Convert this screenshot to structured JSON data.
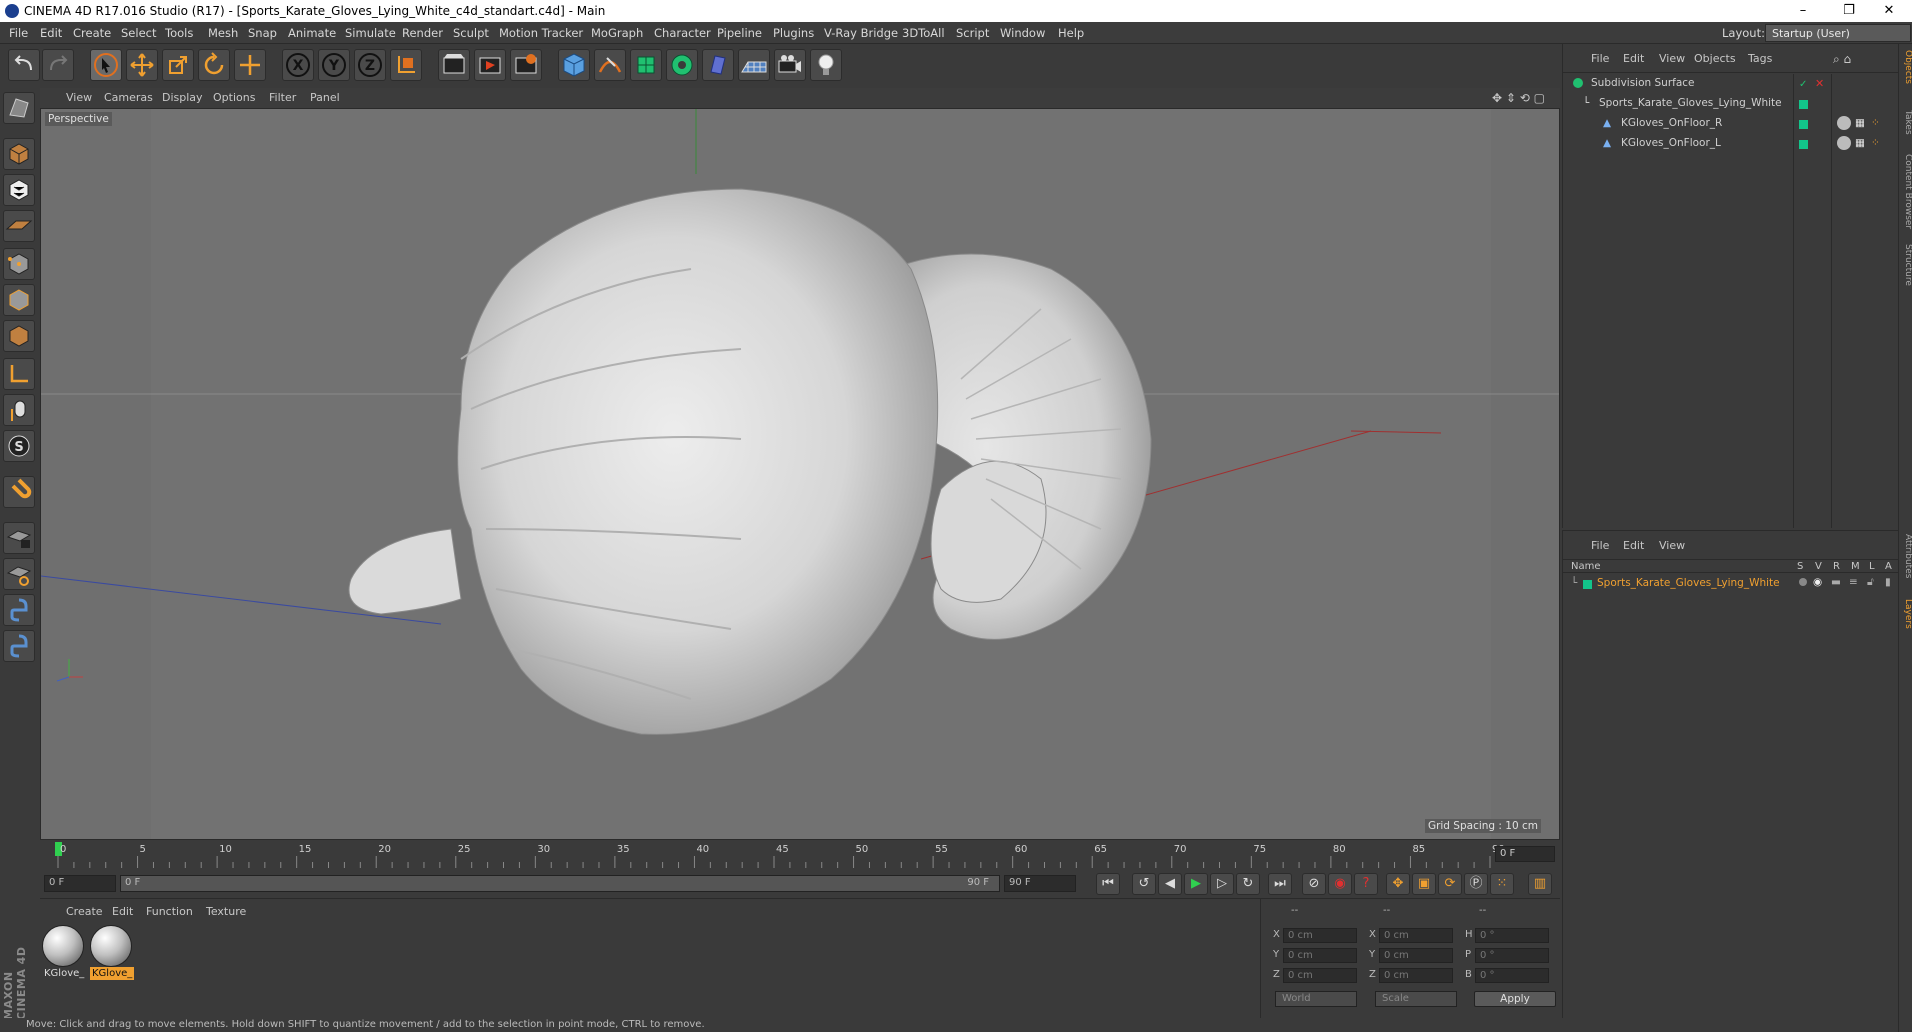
{
  "window": {
    "title": "CINEMA 4D R17.016 Studio (R17) - [Sports_Karate_Gloves_Lying_White_c4d_standart.c4d] - Main",
    "controls": [
      "–",
      "❐",
      "✕"
    ]
  },
  "menu": [
    "File",
    "Edit",
    "Create",
    "Select",
    "Tools",
    "Mesh",
    "Snap",
    "Animate",
    "Simulate",
    "Render",
    "Sculpt",
    "Motion Tracker",
    "MoGraph",
    "Character",
    "Pipeline",
    "Plugins",
    "V-Ray Bridge",
    "3DToAll",
    "Script",
    "Window",
    "Help"
  ],
  "layout": {
    "label": "Layout:",
    "value": "Startup (User)"
  },
  "viewport": {
    "menu": [
      "View",
      "Cameras",
      "Display",
      "Options",
      "Filter",
      "Panel"
    ],
    "camera": "Perspective",
    "grid_spacing": "Grid Spacing : 10 cm"
  },
  "timeline": {
    "ticks": [
      "0",
      "5",
      "10",
      "15",
      "20",
      "25",
      "30",
      "35",
      "40",
      "45",
      "50",
      "55",
      "60",
      "65",
      "70",
      "75",
      "80",
      "85",
      "90"
    ],
    "current_frame": "0 F"
  },
  "transport": {
    "start": "0 F",
    "range_start": "0 F",
    "range_end": "90 F",
    "end": "90 F"
  },
  "materials": {
    "menu": [
      "Create",
      "Edit",
      "Function",
      "Texture"
    ],
    "items": [
      {
        "label": "KGlove_",
        "selected": false
      },
      {
        "label": "KGlove_",
        "selected": true
      }
    ]
  },
  "coords": {
    "header": [
      "--",
      "--",
      "--"
    ],
    "rows": [
      {
        "a": "X",
        "av": "0 cm",
        "b": "X",
        "bv": "0 cm",
        "c": "H",
        "cv": "0 °"
      },
      {
        "a": "Y",
        "av": "0 cm",
        "b": "Y",
        "bv": "0 cm",
        "c": "P",
        "cv": "0 °"
      },
      {
        "a": "Z",
        "av": "0 cm",
        "b": "Z",
        "bv": "0 cm",
        "c": "B",
        "cv": "0 °"
      }
    ],
    "space": "World",
    "mode": "Scale",
    "apply": "Apply"
  },
  "object_manager": {
    "menu": [
      "File",
      "Edit",
      "View",
      "Objects",
      "Tags"
    ],
    "objects": [
      {
        "name": "Subdivision Surface",
        "indent": 0
      },
      {
        "name": "Sports_Karate_Gloves_Lying_White",
        "indent": 1
      },
      {
        "name": "KGloves_OnFloor_R",
        "indent": 2
      },
      {
        "name": "KGloves_OnFloor_L",
        "indent": 2
      }
    ]
  },
  "layer_manager": {
    "menu": [
      "File",
      "Edit",
      "View"
    ],
    "columns": [
      "Name",
      "S",
      "V",
      "R",
      "M",
      "L",
      "A"
    ],
    "layers": [
      {
        "name": "Sports_Karate_Gloves_Lying_White",
        "color": "#12c48a"
      }
    ]
  },
  "side_tabs": [
    "Objects",
    "Takes",
    "Content Browser",
    "Structure",
    "Attributes",
    "Layers"
  ],
  "status": "Move: Click and drag to move elements. Hold down SHIFT to quantize movement / add to the selection in point mode, CTRL to remove.",
  "brand": "MAXON CINEMA 4D",
  "colors": {
    "accent": "#f0a030",
    "layer": "#12c48a",
    "viewport_bg": "#6f6f6f"
  }
}
